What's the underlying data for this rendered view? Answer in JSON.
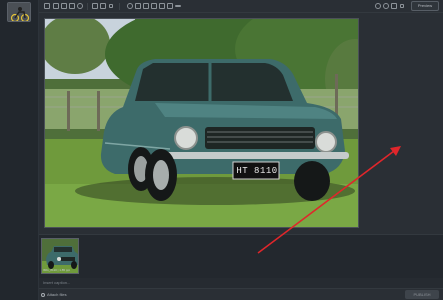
{
  "rail": {
    "avatar_icon": "motorbike-avatar-icon"
  },
  "toolbar": {
    "preview_label": "Preview",
    "icons": [
      "text-icon",
      "bold-icon",
      "italic-icon",
      "heading-icon",
      "link-icon",
      "list-icon",
      "quote-icon",
      "code-icon",
      "image-icon",
      "video-icon",
      "divider-icon",
      "undo-icon",
      "redo-icon",
      "settings-icon"
    ]
  },
  "canvas": {
    "plate_text": "HT 8110"
  },
  "strip": {
    "thumb_caption": "IMG_8110 | 1.85 ppi"
  },
  "caption": {
    "placeholder": "Insert caption..."
  },
  "footer": {
    "attach_label": "Attach files",
    "publish_label": "PUBLISH CHANGES"
  },
  "annotation": {
    "arrow_color": "#e0262b"
  }
}
